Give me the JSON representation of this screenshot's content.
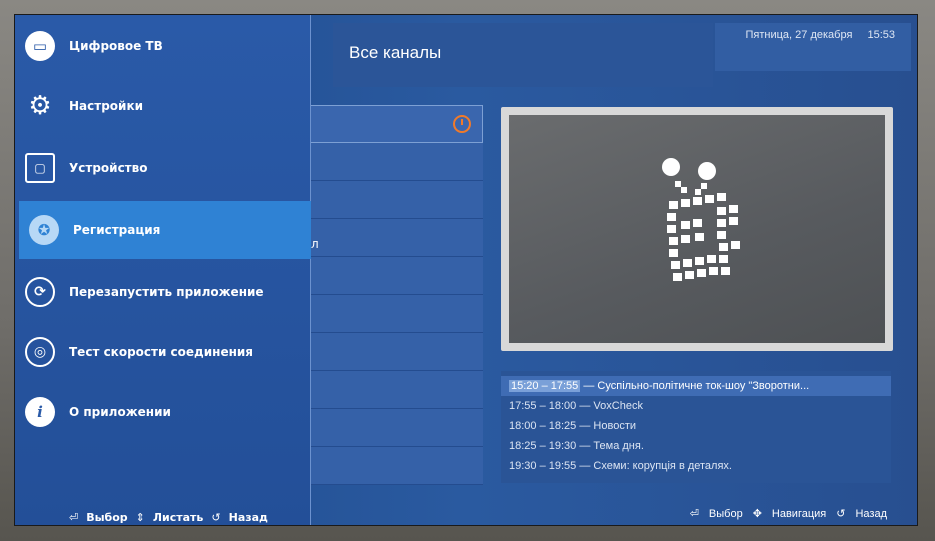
{
  "header": {
    "channels_title": "Все каналы",
    "date": "Пятница, 27 декабря",
    "time": "15:53"
  },
  "channel_list": {
    "fragment_text": "л"
  },
  "epg": {
    "rows": [
      {
        "time": "15:20 – 17:55",
        "title": "Суспільно-політичне ток-шоу \"Зворотни..."
      },
      {
        "time": "17:55 – 18:00",
        "title": "VoxCheck"
      },
      {
        "time": "18:00 – 18:25",
        "title": "Новости"
      },
      {
        "time": "18:25 – 19:30",
        "title": "Тема дня."
      },
      {
        "time": "19:30 – 19:55",
        "title": "Схеми: корупція в деталях."
      }
    ]
  },
  "side_menu": {
    "items": [
      {
        "label": "Цифровое ТВ",
        "icon": "tv-icon"
      },
      {
        "label": "Настройки",
        "icon": "gear-icon"
      },
      {
        "label": "Устройство",
        "icon": "device-icon"
      },
      {
        "label": "Регистрация",
        "icon": "badge-icon"
      },
      {
        "label": "Перезапустить приложение",
        "icon": "restart-icon"
      },
      {
        "label": "Тест скорости соединения",
        "icon": "speedtest-icon"
      },
      {
        "label": "О приложении",
        "icon": "info-icon"
      }
    ],
    "active_index": 3
  },
  "footer_left": {
    "select": "Выбор",
    "scroll": "Листать",
    "back": "Назад"
  },
  "footer_right": {
    "select": "Выбор",
    "navigate": "Навигация",
    "back": "Назад"
  },
  "colors": {
    "accent": "#2f82d4",
    "history_icon": "#f07a2a",
    "background": "#2a5aa0"
  }
}
